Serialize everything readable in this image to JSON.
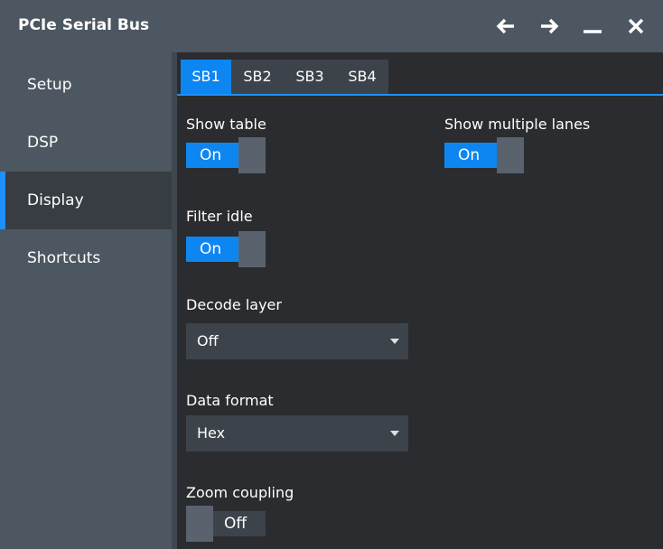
{
  "window": {
    "title": "PCIe Serial Bus"
  },
  "sidebar": {
    "items": [
      {
        "label": "Setup"
      },
      {
        "label": "DSP"
      },
      {
        "label": "Display"
      },
      {
        "label": "Shortcuts"
      }
    ],
    "active_index": 2
  },
  "tabs": [
    {
      "label": "SB1"
    },
    {
      "label": "SB2"
    },
    {
      "label": "SB3"
    },
    {
      "label": "SB4"
    }
  ],
  "form": {
    "show_table": {
      "label": "Show table",
      "value": "On"
    },
    "show_multiple_lanes": {
      "label": "Show multiple lanes",
      "value": "On"
    },
    "filter_idle": {
      "label": "Filter idle",
      "value": "On"
    },
    "decode_layer": {
      "label": "Decode layer",
      "value": "Off"
    },
    "data_format": {
      "label": "Data format",
      "value": "Hex"
    },
    "zoom_coupling": {
      "label": "Zoom coupling",
      "value": "Off"
    }
  },
  "icons": {
    "back": "arrow-left-icon",
    "forward": "arrow-right-icon",
    "minimize": "minimize-icon",
    "close": "close-icon"
  },
  "colors": {
    "accent": "#0e86f2",
    "titlebar": "#4d5761",
    "background": "#2a2c2f"
  }
}
